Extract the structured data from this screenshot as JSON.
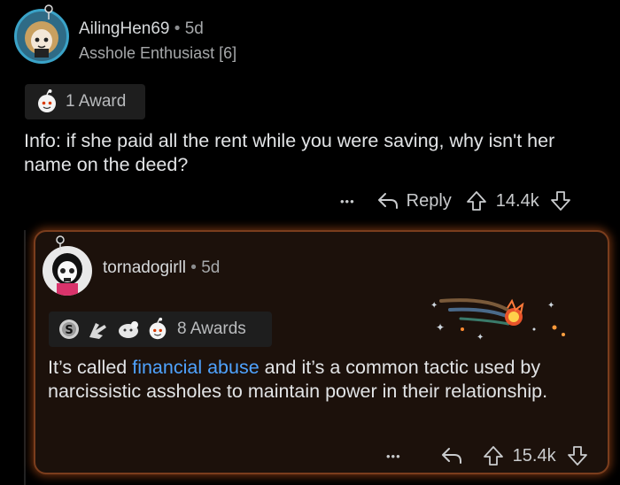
{
  "comment1": {
    "username": "AilingHen69",
    "time": "5d",
    "flair": "Asshole Enthusiast [6]",
    "awards_label": "1 Award",
    "text": "Info: if she paid all the rent while you were saving, why isn't her name on the deed?",
    "more": "•••",
    "reply_label": "Reply",
    "score": "14.4k"
  },
  "comment2": {
    "username": "tornadogirll",
    "time": "5d",
    "awards_label": "8 Awards",
    "text_before": "It’s called ",
    "link_text": "financial abuse",
    "text_after": " and it’s a common tactic used by narcissistic assholes to maintain power in their relationship.",
    "more": "•••",
    "score": "15.4k"
  },
  "separator": "•",
  "colors": {
    "background": "#000000",
    "link": "#4fa3ff",
    "glow": "#c85a1e"
  },
  "icons": [
    "reddit-award-icon",
    "silver-award-icon",
    "clapping-award-icon",
    "wholesome-award-icon",
    "reply-arrow-icon",
    "upvote-icon",
    "downvote-icon",
    "comet-award-icon"
  ]
}
